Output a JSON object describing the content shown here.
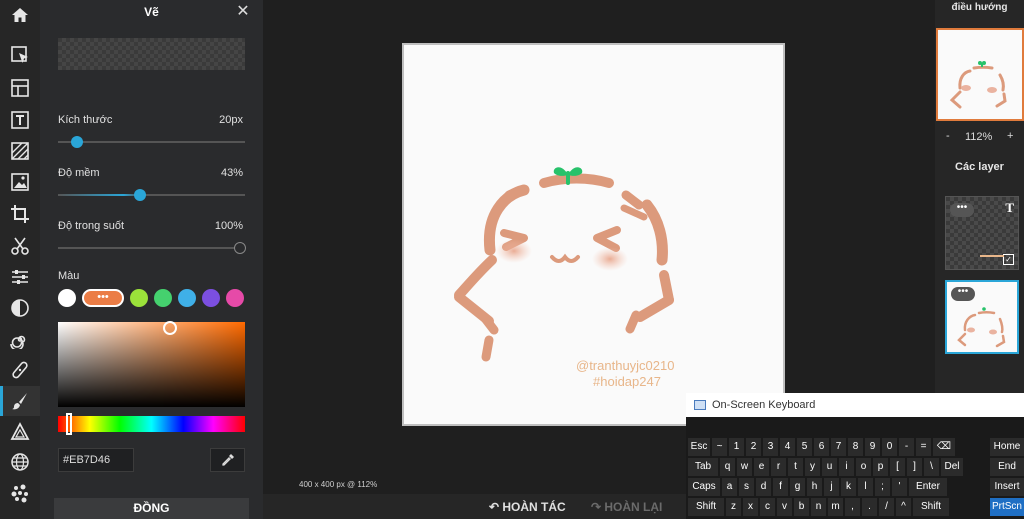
{
  "tools": [
    {
      "name": "home-icon"
    },
    {
      "name": "select-icon"
    },
    {
      "name": "layout-icon"
    },
    {
      "name": "text-icon"
    },
    {
      "name": "texture-icon"
    },
    {
      "name": "image-icon"
    },
    {
      "name": "crop-icon"
    },
    {
      "name": "cut-icon"
    },
    {
      "name": "adjust-icon"
    },
    {
      "name": "contrast-icon"
    },
    {
      "name": "spiral-icon"
    },
    {
      "name": "bandage-icon"
    },
    {
      "name": "brush-icon"
    },
    {
      "name": "shape-icon"
    },
    {
      "name": "globe-icon"
    },
    {
      "name": "dots-icon"
    }
  ],
  "panel": {
    "title": "Vẽ",
    "size_label": "Kích thước",
    "size_value": "20px",
    "size_level": 0.1,
    "softness_label": "Độ mềm",
    "softness_value": "43%",
    "softness_level": 0.43,
    "opacity_label": "Độ trong suốt",
    "opacity_value": "100%",
    "opacity_level": 1.0,
    "color_label": "Màu",
    "active_swatch_label": "•••",
    "swatches": [
      "#ffffff",
      "#EB7D46",
      "#9be23a",
      "#45d16e",
      "#3fb0e8",
      "#7b4fe0",
      "#e64aa8"
    ],
    "hex_value": "#EB7D46",
    "done_label": "ĐỒNG"
  },
  "canvas": {
    "watermark_user": "@tranthuyjc0210",
    "watermark_tag": "#hoidap247",
    "status": "400 x 400 px @ 112%"
  },
  "actions": {
    "undo": "HOÀN TÁC",
    "redo": "HOÀN LẠI"
  },
  "right": {
    "navigator_title": "điều hướng",
    "zoom_minus": "-",
    "zoom_value": "112%",
    "zoom_plus": "+",
    "layers_title": "Các layer",
    "layer_menu": "•••"
  },
  "osk": {
    "title": "On-Screen Keyboard",
    "rows": [
      [
        "Esc",
        "~",
        "1",
        "2",
        "3",
        "4",
        "5",
        "6",
        "7",
        "8",
        "9",
        "0",
        "-",
        "=",
        "⌫"
      ],
      [
        "Tab",
        "q",
        "w",
        "e",
        "r",
        "t",
        "y",
        "u",
        "i",
        "o",
        "p",
        "[",
        "]",
        "\\",
        "Del"
      ],
      [
        "Caps",
        "a",
        "s",
        "d",
        "f",
        "g",
        "h",
        "j",
        "k",
        "l",
        ";",
        "'",
        "Enter"
      ],
      [
        "Shift",
        "z",
        "x",
        "c",
        "v",
        "b",
        "n",
        "m",
        ",",
        ".",
        "/",
        "^",
        "Shift"
      ]
    ],
    "side_keys": [
      "Home",
      "End",
      "Insert",
      "PrtScn"
    ]
  }
}
